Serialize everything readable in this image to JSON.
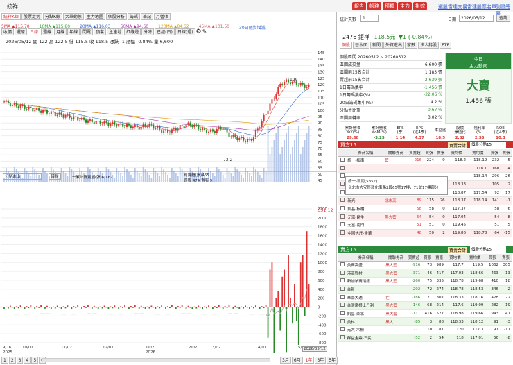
{
  "title": "統祥",
  "top_buttons": [
    "報告",
    "帳務",
    "種類",
    "主力",
    "掛蛇"
  ],
  "top_links": [
    "選股雷達",
    "交易雷達",
    "股票名單",
    "副畫總表"
  ],
  "chart_tabs": [
    "統祥K線",
    "股票走勢",
    "分點K線",
    "大單動態",
    "主力地圖",
    "個股分析",
    "籌碼",
    "筆記",
    "月營收"
  ],
  "chart_tabs2": [
    "收價",
    "還原",
    "日線",
    "週線",
    "月線",
    "年線",
    "閃電",
    "頂套",
    "主連地",
    "紅綠燈",
    "分時",
    "已經(日)",
    "日線(週)"
  ],
  "ma_labels": [
    "5MA ▲115.70",
    "10MA ▲115.80",
    "20MA ▲116.03",
    "60MA ▲94.60",
    "120MA ▲84.62",
    "45MA ▲101.50",
    "30日融資增減"
  ],
  "ohlc": "2026/05/12  開 122  高 122.5  低 115.5  收 118.5  漲跌 -1  漲幅 -0.84%  量 6,600",
  "price_axis": [
    "145",
    "140",
    "135",
    "130",
    "125",
    "120",
    "115",
    "110",
    "105",
    "100",
    "95",
    "90",
    "85",
    "80",
    "75",
    "70",
    "65",
    "60",
    "55",
    "50",
    "45"
  ],
  "price_hi": "129",
  "price_lo": "72.2",
  "sub_axis": [
    "2200",
    "2000",
    "1800",
    "1600",
    "1400",
    "1200",
    "1000",
    "800",
    "600",
    "400",
    "200",
    "0",
    "-200",
    "-400",
    "-600",
    "-800"
  ],
  "sub_hi": "651.12",
  "sub_legend": {
    "sel": "分點進出",
    "btn": "確點",
    "l1": "一累計買賣超(張)6,167",
    "l2": "買賣超(張)465",
    "l3": "買張 474 賣張 9"
  },
  "x_axis": [
    "9/16\n2025",
    "10/01",
    "11/02",
    "12/01",
    "1/02\n2026",
    "2/02",
    "3/02",
    "4/01",
    "5/..."
  ],
  "date_badge": "2026/05/12",
  "pages": [
    "1",
    "2",
    "3",
    "4",
    "5",
    "6"
  ],
  "periods": [
    "3月",
    "6月",
    "1年",
    "3年",
    "5年"
  ],
  "right_sel": "1",
  "date_box": "2026/05/12",
  "search_btn": "查詢",
  "stock_line": {
    "code": "2476 鉅祥",
    "price": "118.5元",
    "chg": "▼1 (-0.84%)"
  },
  "subtabs": [
    "個股",
    "基本面",
    "新聞",
    "外資進出",
    "家數",
    "法人持股",
    "ETF"
  ],
  "panel_rows": [
    [
      "個股區間  20260512 ~ 20260512",
      ""
    ],
    [
      "區間成交量",
      "6,600 張"
    ],
    [
      "區間前15名合計",
      "1,183 張"
    ],
    [
      "賣超前15名合計",
      "-2,639 張"
    ],
    [
      "1日籌碼集中",
      "-1,456 張"
    ],
    [
      "1日籌碼集中(%)",
      "-22.06 %"
    ],
    [
      "20日籌碼集中(%)",
      "4.2 %"
    ],
    [
      "分點主比重",
      "-0.67 %"
    ],
    [
      "區間周轉率",
      "3.02 %"
    ]
  ],
  "today": {
    "h1": "今日",
    "h2": "主力動向",
    "main": "大賣",
    "vol": "1,456 張"
  },
  "fund_h": [
    "累計營收\nYoY(%)",
    "累計營收\nMoM(%)",
    "EPS\n(季)",
    "EPS\n(近4季)",
    "本益比",
    "股價\n淨值比",
    "殖利率\n(%)",
    "ROE\n(近4季)"
  ],
  "fund_v": [
    "29.68",
    "-3.25",
    "1.14",
    "4.37",
    "18.5",
    "2.82",
    "2.53",
    "10.3"
  ],
  "buy_title": "買方15",
  "sell_title": "賣方15",
  "combo": "買賣合計",
  "select_txt": "個股分點15",
  "cols": [
    "券商名稱",
    "關聯券商",
    "買賣超",
    "買張",
    "賣張",
    "買均價",
    "賣均價",
    "買張",
    "賣張"
  ],
  "buy_rows": [
    [
      "統一-松南",
      "藍",
      "216",
      "224",
      "9",
      "118.2",
      "118.19",
      "232",
      "5"
    ],
    [
      "",
      "",
      "",
      "",
      "",
      "",
      "118.1",
      "160",
      "4"
    ],
    [
      "",
      "",
      "",
      "",
      "",
      "",
      "118.14",
      "296",
      "-26"
    ],
    [
      "元富-大安",
      "藍",
      "105",
      "105",
      "0",
      "118.33",
      "",
      "105",
      "2"
    ],
    [
      "凱基-信義",
      "黑大藍",
      "90",
      "91",
      "1",
      "118.87",
      "117.54",
      "92",
      "17"
    ],
    [
      "新光",
      "北市高",
      "89",
      "115",
      "26",
      "118.37",
      "118.14",
      "141",
      "-1"
    ],
    [
      "凱基-板橋",
      "",
      "58",
      "58",
      "0",
      "117.37",
      "",
      "58",
      "6"
    ],
    [
      "元富-民生",
      "黑大藍",
      "54",
      "54",
      "0",
      "117.04",
      "",
      "54",
      "8"
    ],
    [
      "元富-南門",
      "",
      "51",
      "51",
      "0",
      "119.45",
      "",
      "51",
      "5"
    ],
    [
      "中國信託-金華",
      "",
      "48",
      "50",
      "2",
      "119.86",
      "118.78",
      "64",
      "-15"
    ]
  ],
  "tooltip": [
    "統一-敦南(585Z)",
    "台北市大安區敦化南路2段65號17樓，71號17樓部分"
  ],
  "sell_rows": [
    [
      "美商高盛",
      "黑大藍",
      "-916",
      "73",
      "989",
      "117.7",
      "119.5",
      "1062",
      "305"
    ],
    [
      "港商野村",
      "黑大藍",
      "-371",
      "46",
      "417",
      "117.03",
      "118.66",
      "463",
      "13"
    ],
    [
      "新加坡商瑞銀",
      "黑大藍",
      "-260",
      "75",
      "335",
      "118.78",
      "119.68",
      "410",
      "18"
    ],
    [
      "台新",
      "",
      "-202",
      "72",
      "274",
      "118.78",
      "118.53",
      "346",
      "2"
    ],
    [
      "華南大通",
      "在",
      "-186",
      "121",
      "307",
      "118.33",
      "118.16",
      "428",
      "22"
    ],
    [
      "台灣摩根士丹利",
      "黑大藍",
      "-146",
      "68",
      "214",
      "117.6",
      "119.09",
      "282",
      "19"
    ],
    [
      "凱基-台北",
      "黑大藍",
      "-111",
      "416",
      "527",
      "118.98",
      "119.66",
      "943",
      "41"
    ],
    [
      "美林",
      "黑大",
      "-85",
      "3",
      "88",
      "118.33",
      "118.12",
      "91",
      "-3"
    ],
    [
      "元大-木柵",
      "",
      "-71",
      "10",
      "81",
      "120",
      "117.3",
      "91",
      "-11"
    ],
    [
      "群益金鼎-三民",
      "",
      "-52",
      "2",
      "54",
      "118",
      "117.01",
      "56",
      "-8"
    ]
  ],
  "icons": {
    "search": "search-icon",
    "gear": "gear-icon",
    "pen": "pen-icon",
    "check": "check-icon",
    "up": "red",
    "down": "green"
  }
}
